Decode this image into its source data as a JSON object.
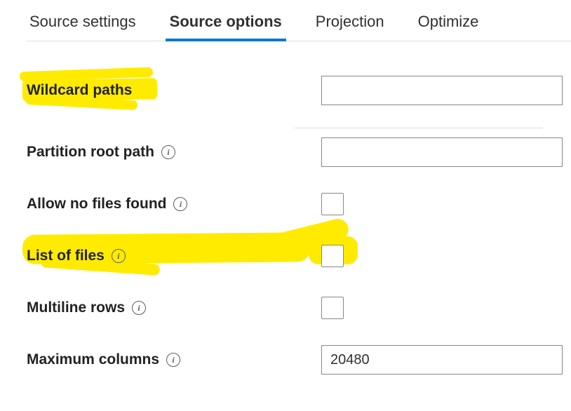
{
  "tabs": {
    "source_settings": "Source settings",
    "source_options": "Source options",
    "projection": "Projection",
    "optimize": "Optimize"
  },
  "form": {
    "wildcard_paths": {
      "label": "Wildcard paths",
      "value": ""
    },
    "partition_root_path": {
      "label": "Partition root path",
      "value": ""
    },
    "allow_no_files_found": {
      "label": "Allow no files found",
      "checked": false
    },
    "list_of_files": {
      "label": "List of files",
      "checked": false
    },
    "multiline_rows": {
      "label": "Multiline rows",
      "checked": false
    },
    "maximum_columns": {
      "label": "Maximum columns",
      "value": "20480"
    }
  },
  "colors": {
    "accent": "#0078d4",
    "highlighter": "#ffeb00"
  }
}
